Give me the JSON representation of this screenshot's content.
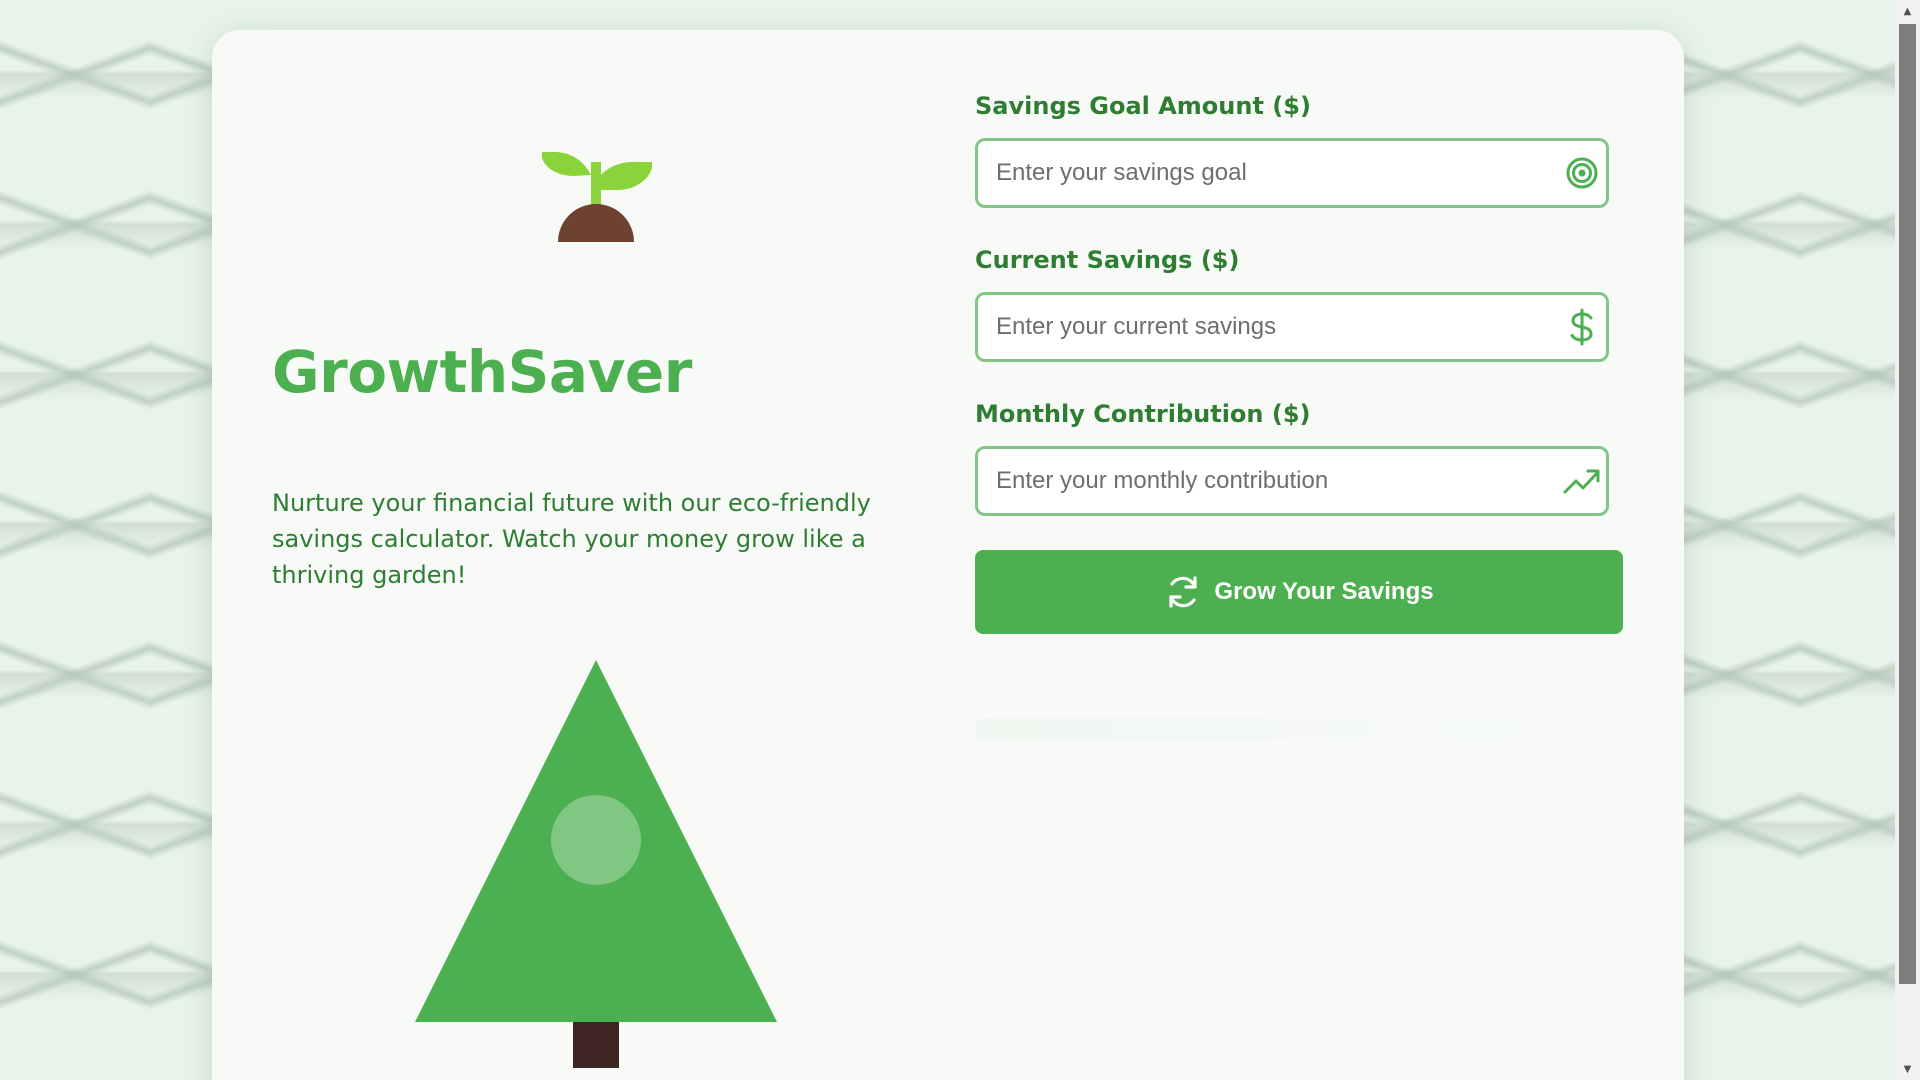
{
  "app": {
    "brand": "GrowthSaver",
    "tagline": "Nurture your financial future with our eco-friendly savings calculator. Watch your money grow like a thriving garden!"
  },
  "form": {
    "goal": {
      "label": "Savings Goal Amount ($)",
      "placeholder": "Enter your savings goal",
      "value": "",
      "icon": "target-icon"
    },
    "current": {
      "label": "Current Savings ($)",
      "placeholder": "Enter your current savings",
      "value": "",
      "icon": "dollar-icon"
    },
    "monthly": {
      "label": "Monthly Contribution ($)",
      "placeholder": "Enter your monthly contribution",
      "value": "",
      "icon": "trend-up-icon"
    },
    "submit_label": "Grow Your Savings",
    "submit_icon": "refresh-icon"
  },
  "colors": {
    "primary": "#4caf50",
    "primary_dark": "#2e7d32",
    "input_border": "#81c784",
    "leaf": "#8bd33a",
    "soil": "#6d4230",
    "trunk": "#3e2723",
    "ornament": "#81c784",
    "background": "#e8f4ea",
    "card": "#f7faf7"
  },
  "decor": {
    "sprout_icon": "sprout-icon",
    "tree_icon": "tree-icon"
  }
}
